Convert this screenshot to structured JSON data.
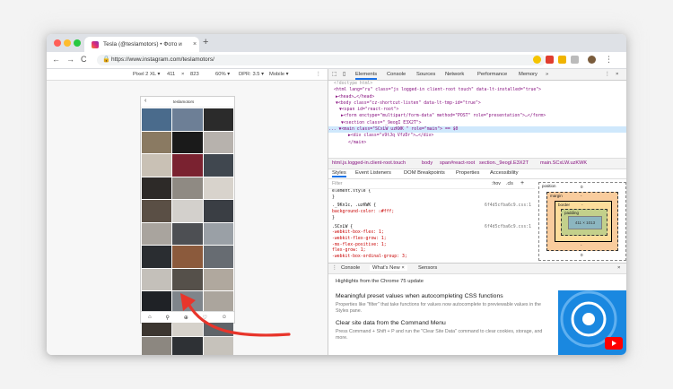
{
  "browser": {
    "tab_title": "Tesla (@teslamotors) • Фото и",
    "tab_close": "×",
    "new_tab": "+",
    "url": "https://www.instagram.com/teslamotors/",
    "back": "←",
    "forward": "→",
    "reload": "C",
    "traffic_colors": [
      "#ff5f57",
      "#febc2e",
      "#28c840"
    ]
  },
  "device_toolbar": {
    "device": "Pixel 2 XL ▾",
    "width": "411",
    "times": "×",
    "height": "823",
    "zoom": "60% ▾",
    "dpr": "DPR: 3.5 ▾",
    "mode": "Mobile ▾",
    "more": "⋮"
  },
  "phone": {
    "username": "teslamotors",
    "back": "‹",
    "nav_icons": [
      "home-icon",
      "search-icon",
      "add-post-icon",
      "heart-icon",
      "profile-icon"
    ],
    "tile_colors": [
      "#4a6b8c",
      "#6d7f96",
      "#2b2b2b",
      "#8a7a62",
      "#1a1a1a",
      "#b7b2ad",
      "#c9c1b5",
      "#7a2230",
      "#40474f",
      "#2d2a28",
      "#8f8a83",
      "#d8d3cc",
      "#5a4f45",
      "#d3d0cc",
      "#3a3e44",
      "#a9a49e",
      "#4d4f53",
      "#9aa0a6",
      "#2a2d31",
      "#8b5a3c",
      "#676c72",
      "#c4c0ba",
      "#55504a",
      "#b0a89e",
      "#1f2226",
      "#7f858b",
      "#aba59d",
      "#3c3630",
      "#d6d2cb",
      "#5f6469",
      "#8c8780",
      "#2e3135",
      "#c6c2bb"
    ]
  },
  "devtools": {
    "tabs": [
      "Elements",
      "Console",
      "Sources",
      "Network",
      "Performance",
      "Memory",
      "»"
    ],
    "dom_lines": [
      "<!doctype html>",
      "<html lang=\"ru\" class=\"js logged-in client-root touch\" data-lt-installed=\"true\">",
      "▶<head>…</head>",
      "▼<body class=\"cz-shortcut-listen\" data-lt-tmp-id=\"true\">",
      "  ▼<span id=\"react-root\">",
      "    ▶<form enctype=\"multipart/form-data\" method=\"POST\" role=\"presentation\">…</form>",
      "    ▼<section class=\"_9eogI E3X2T\">",
      "...    ▼<main class=\"SCxLW uzKWK \" role=\"main\"> == $0",
      "        ▶<div class=\"v9tJq VfzDr\">…</div>",
      "      </main>"
    ],
    "breadcrumbs": [
      "html.js.logged-in.client-root.touch",
      "body",
      "span#react-root",
      "section._9eogI.E3X2T",
      "main.SCxLW.uzKWK"
    ],
    "subtabs": [
      "Styles",
      "Event Listeners",
      "DOM Breakpoints",
      "Properties",
      "Accessibility"
    ],
    "filter_placeholder": "Filter",
    "filter_hov": ":hov",
    "filter_cls": ".cls",
    "filter_add": "+",
    "styles": [
      {
        "text": "element.style {",
        "src": ""
      },
      {
        "text": "}",
        "src": ""
      },
      {
        "text": "._9Kn1c, .uzKWK {",
        "src": "6f4d5cfba6c9.css:1"
      },
      {
        "text": "  background-color: ☐#fff;",
        "src": ""
      },
      {
        "text": "}",
        "src": ""
      },
      {
        "text": ".SCxLW {",
        "src": "6f4d5cfba6c9.css:1"
      },
      {
        "text": "  -webkit-box-flex: 1;",
        "src": ""
      },
      {
        "text": "  -webkit-flex-grow: 1;",
        "src": ""
      },
      {
        "text": "  -ms-flex-positive: 1;",
        "src": ""
      },
      {
        "text": "  flex-grow: 1;",
        "src": ""
      },
      {
        "text": "  -webkit-box-ordinal-group: 3;",
        "src": ""
      }
    ],
    "box_model": {
      "position": "position",
      "margin": "margin",
      "border": "border",
      "padding": "padding",
      "content": "411 × 1013",
      "zero": "0",
      "dash": "-"
    },
    "drawer_tabs": [
      "Console",
      "What's New ×",
      "Sensors"
    ],
    "whats_new_header": "Highlights from the Chrome 75 update",
    "items": [
      {
        "title": "Meaningful preset values when autocompleting CSS functions",
        "desc": "Properties like \"filter\" that take functions for values now autocomplete to previewable values in the Styles pane."
      },
      {
        "title": "Clear site data from the Command Menu",
        "desc": "Press Command + Shift + P and run the \"Clear Site Data\" command to clear cookies, storage, and more."
      }
    ]
  },
  "colors": {
    "accent": "#1a73e8",
    "arrow": "#e8352b"
  }
}
